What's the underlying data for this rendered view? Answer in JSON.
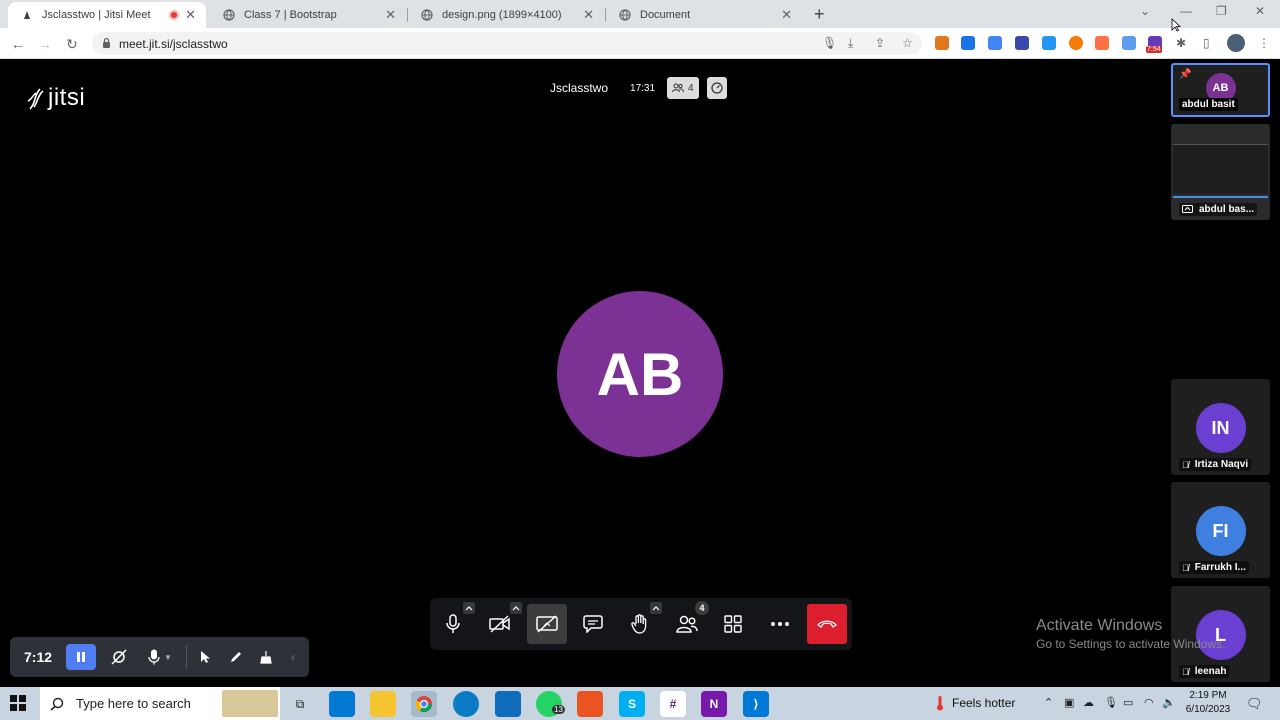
{
  "browser": {
    "tabs": [
      {
        "title": "Jsclasstwo | Jitsi Meet",
        "active": true,
        "recording": true
      },
      {
        "title": "Class 7 | Bootstrap",
        "active": false
      },
      {
        "title": "design.png (1899×4100)",
        "active": false
      },
      {
        "title": "Document",
        "active": false
      }
    ],
    "url": "meet.jit.si/jsclasstwo",
    "ext_badge": "7:54"
  },
  "meeting": {
    "logo": "jitsi",
    "subject": "Jsclasstwo",
    "timer": "17:31",
    "participant_count": "4",
    "dominant_initials": "AB",
    "dominant_color": "#7b3294",
    "filmstrip": [
      {
        "initials": "AB",
        "name": "abdul basit",
        "color": "#7b3294",
        "pinned": true
      },
      {
        "initials": "",
        "name": "abdul bas...",
        "screenshare": true
      },
      {
        "initials": "IN",
        "name": "Irtiza Naqvi",
        "color": "#6a3fd1"
      },
      {
        "initials": "FI",
        "name": "Farrukh I...",
        "color": "#3f7fe0"
      },
      {
        "initials": "L",
        "name": "leenah",
        "color": "#6a3fd1"
      }
    ],
    "toolbar_badge": "4"
  },
  "watermark": {
    "line1": "Activate Windows",
    "line2": "Go to Settings to activate Windows."
  },
  "recorder": {
    "elapsed": "7:12"
  },
  "taskbar": {
    "search_placeholder": "Type here to search",
    "whatsapp_badge": "13",
    "weather": "Feels hotter",
    "time": "2:19 PM",
    "date": "6/10/2023"
  }
}
